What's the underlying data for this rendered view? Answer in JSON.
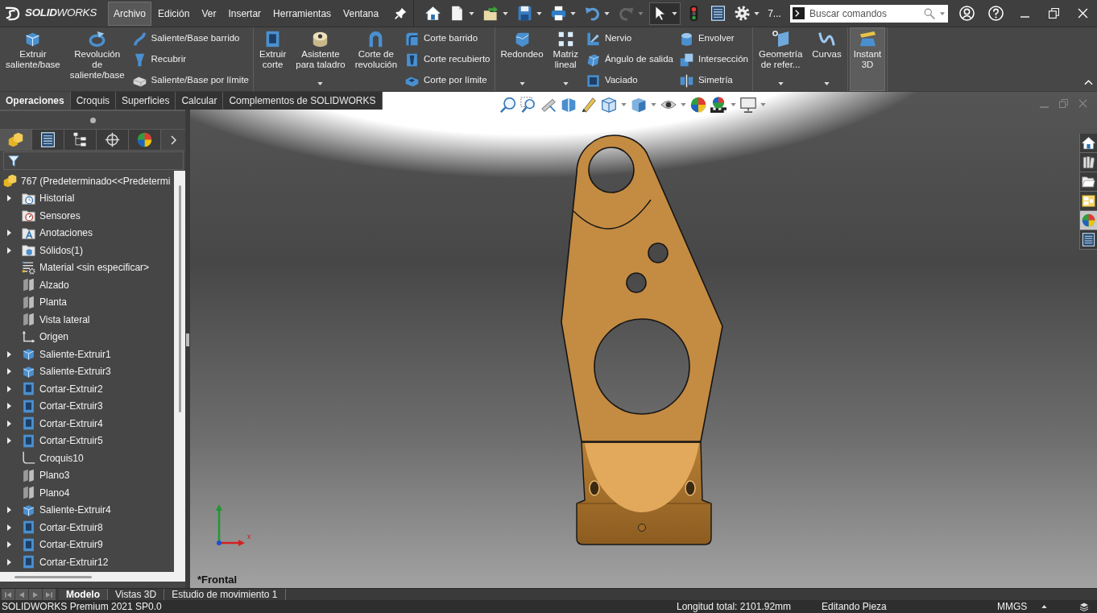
{
  "title_bar": {
    "logo": "**SOLID**WORKS",
    "menus": [
      {
        "label": "Archivo",
        "selected": true
      },
      {
        "label": "Edición",
        "selected": false
      },
      {
        "label": "Ver",
        "selected": false
      },
      {
        "label": "Insertar",
        "selected": false
      },
      {
        "label": "Herramientas",
        "selected": false
      },
      {
        "label": "Ventana",
        "selected": false
      }
    ],
    "tools": [
      {
        "kind": "home",
        "dropdown": false,
        "disabled": false,
        "pressed": false
      },
      {
        "kind": "new",
        "dropdown": true,
        "disabled": false,
        "pressed": false
      },
      {
        "kind": "open",
        "dropdown": true,
        "disabled": false,
        "pressed": false
      },
      {
        "kind": "save",
        "dropdown": true,
        "disabled": false,
        "pressed": false
      },
      {
        "kind": "print",
        "dropdown": true,
        "disabled": false,
        "pressed": false
      },
      {
        "kind": "undo",
        "dropdown": true,
        "disabled": false,
        "pressed": false
      },
      {
        "kind": "redo",
        "dropdown": true,
        "disabled": true,
        "pressed": false
      },
      {
        "kind": "select",
        "dropdown": true,
        "disabled": false,
        "pressed": true
      },
      {
        "kind": "rebuild",
        "dropdown": false,
        "disabled": false,
        "pressed": false
      },
      {
        "kind": "file-properties",
        "dropdown": false,
        "disabled": false,
        "pressed": false
      },
      {
        "kind": "options",
        "dropdown": true,
        "disabled": false,
        "pressed": false
      }
    ],
    "document": "7...",
    "search": {
      "placeholder": "Buscar comandos"
    }
  },
  "ribbon": {
    "groups": [
      {
        "buttons": [
          {
            "kind": "extrude",
            "lines": [
              "Extruir",
              "saliente/base"
            ],
            "dropdown": false,
            "pressed": false
          },
          {
            "kind": "revolve",
            "lines": [
              "Revolución",
              "de",
              "saliente/base"
            ],
            "dropdown": false,
            "pressed": false
          }
        ],
        "stacks": [
          {
            "items": [
              {
                "kind": "sweep",
                "label": "Saliente/Base barrido"
              },
              {
                "kind": "loft",
                "label": "Recubrir"
              },
              {
                "kind": "boundary",
                "label": "Saliente/Base por límite"
              }
            ]
          }
        ]
      },
      {
        "buttons": [
          {
            "kind": "extrude-cut",
            "lines": [
              "Extruir",
              "corte"
            ],
            "dropdown": false,
            "pressed": false
          },
          {
            "kind": "hole-wizard",
            "lines": [
              "Asistente",
              "para taladro"
            ],
            "dropdown": true,
            "pressed": false
          },
          {
            "kind": "revolve-cut",
            "lines": [
              "Corte de",
              "revolución"
            ],
            "dropdown": false,
            "pressed": false
          }
        ],
        "stacks": [
          {
            "items": [
              {
                "kind": "sweep-cut",
                "label": "Corte barrido"
              },
              {
                "kind": "loft-cut",
                "label": "Corte recubierto"
              },
              {
                "kind": "boundary-cut",
                "label": "Corte por límite"
              }
            ]
          }
        ]
      },
      {
        "buttons": [
          {
            "kind": "fillet",
            "lines": [
              "Redondeo"
            ],
            "dropdown": true,
            "pressed": false
          },
          {
            "kind": "linear-pattern",
            "lines": [
              "Matriz",
              "lineal"
            ],
            "dropdown": true,
            "pressed": false
          }
        ],
        "stacks": [
          {
            "items": [
              {
                "kind": "rib",
                "label": "Nervio"
              },
              {
                "kind": "draft",
                "label": "Ángulo de salida"
              },
              {
                "kind": "shell",
                "label": "Vaciado"
              }
            ]
          },
          {
            "items": [
              {
                "kind": "wrap",
                "label": "Envolver"
              },
              {
                "kind": "intersect",
                "label": "Intersección"
              },
              {
                "kind": "mirror",
                "label": "Simetría"
              }
            ]
          }
        ]
      },
      {
        "buttons": [
          {
            "kind": "ref-geometry",
            "lines": [
              "Geometría",
              "de refer..."
            ],
            "dropdown": true,
            "pressed": false
          },
          {
            "kind": "curves",
            "lines": [
              "Curvas"
            ],
            "dropdown": true,
            "pressed": false
          }
        ]
      },
      {
        "buttons": [
          {
            "kind": "instant3d",
            "lines": [
              "Instant",
              "3D"
            ],
            "dropdown": false,
            "pressed": true
          }
        ]
      }
    ]
  },
  "command_tabs": [
    {
      "label": "Operaciones",
      "selected": true
    },
    {
      "label": "Croquis",
      "selected": false
    },
    {
      "label": "Superficies",
      "selected": false
    },
    {
      "label": "Calcular",
      "selected": false
    },
    {
      "label": "Complementos de SOLIDWORKS",
      "selected": false
    }
  ],
  "feature_manager": {
    "tabs": [
      {
        "kind": "feature-tree",
        "selected": true
      },
      {
        "kind": "property-manager",
        "selected": false
      },
      {
        "kind": "configuration",
        "selected": false
      },
      {
        "kind": "dimxpert",
        "selected": false
      },
      {
        "kind": "display-manager",
        "selected": false
      }
    ],
    "tree": {
      "kind": "part",
      "label": "767 (Predeterminado<<Predetermi",
      "children": [
        {
          "kind": "history",
          "label": "Historial",
          "expandable": true
        },
        {
          "kind": "sensors",
          "label": "Sensores",
          "expandable": false
        },
        {
          "kind": "annotations",
          "label": "Anotaciones",
          "expandable": true
        },
        {
          "kind": "solids",
          "label": "Sólidos(1)",
          "expandable": true
        },
        {
          "kind": "material",
          "label": "Material <sin especificar>",
          "expandable": false
        },
        {
          "kind": "plane",
          "label": "Alzado",
          "expandable": false
        },
        {
          "kind": "plane",
          "label": "Planta",
          "expandable": false
        },
        {
          "kind": "plane",
          "label": "Vista lateral",
          "expandable": false
        },
        {
          "kind": "origin",
          "label": "Origen",
          "expandable": false
        },
        {
          "kind": "boss",
          "label": "Saliente-Extruir1",
          "expandable": true
        },
        {
          "kind": "boss",
          "label": "Saliente-Extruir3",
          "expandable": true
        },
        {
          "kind": "cut",
          "label": "Cortar-Extruir2",
          "expandable": true
        },
        {
          "kind": "cut",
          "label": "Cortar-Extruir3",
          "expandable": true
        },
        {
          "kind": "cut",
          "label": "Cortar-Extruir4",
          "expandable": true
        },
        {
          "kind": "cut",
          "label": "Cortar-Extruir5",
          "expandable": true
        },
        {
          "kind": "sketch",
          "label": "Croquis10",
          "expandable": false
        },
        {
          "kind": "plane",
          "label": "Plano3",
          "expandable": false
        },
        {
          "kind": "plane",
          "label": "Plano4",
          "expandable": false
        },
        {
          "kind": "boss",
          "label": "Saliente-Extruir4",
          "expandable": true
        },
        {
          "kind": "cut",
          "label": "Cortar-Extruir8",
          "expandable": true
        },
        {
          "kind": "cut",
          "label": "Cortar-Extruir9",
          "expandable": true
        },
        {
          "kind": "cut",
          "label": "Cortar-Extruir12",
          "expandable": true
        }
      ]
    }
  },
  "viewport": {
    "view_tools": [
      {
        "kind": "zoom-fit",
        "dropdown": false
      },
      {
        "kind": "zoom-area",
        "dropdown": false
      },
      {
        "kind": "previous-view",
        "dropdown": false
      },
      {
        "kind": "section",
        "dropdown": false
      },
      {
        "kind": "annotation-view",
        "dropdown": false
      },
      {
        "kind": "orientation",
        "dropdown": true
      },
      {
        "kind": "display-style",
        "dropdown": true
      },
      {
        "kind": "hide-show",
        "dropdown": true
      },
      {
        "kind": "edit-appearance",
        "dropdown": false
      },
      {
        "kind": "scene",
        "dropdown": true
      },
      {
        "kind": "view-settings",
        "dropdown": true
      }
    ],
    "task_pane": [
      {
        "kind": "home",
        "selected": false
      },
      {
        "kind": "library",
        "selected": false
      },
      {
        "kind": "folder",
        "selected": false
      },
      {
        "kind": "view-palette",
        "selected": false
      },
      {
        "kind": "appearances",
        "selected": true
      },
      {
        "kind": "custom-properties",
        "selected": false
      }
    ],
    "triad_label": "x",
    "view_name": "*Frontal"
  },
  "bottom_tabs": [
    {
      "label": "Modelo",
      "selected": true
    },
    {
      "label": "Vistas 3D",
      "selected": false
    },
    {
      "label": "Estudio de movimiento 1",
      "selected": false
    }
  ],
  "status_bar": {
    "product": "SOLIDWORKS Premium 2021 SP0.0",
    "length": "Longitud total: 2101.92mm",
    "mode": "Editando Pieza",
    "units": "MMGS"
  }
}
